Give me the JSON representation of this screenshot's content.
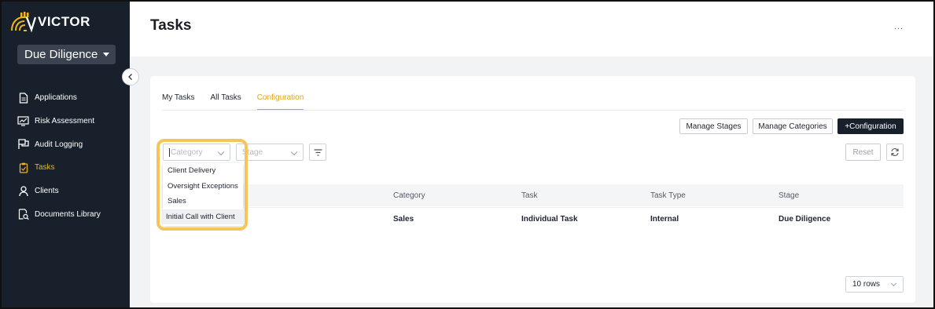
{
  "brand": {
    "name": "VICTOR",
    "accent": "#f0b51e"
  },
  "module_select": {
    "value": "Due Diligence"
  },
  "sidebar": {
    "items": [
      {
        "label": "Applications",
        "icon": "document-icon"
      },
      {
        "label": "Risk Assessment",
        "icon": "chart-monitor-icon"
      },
      {
        "label": "Audit Logging",
        "icon": "flag-icon"
      },
      {
        "label": "Tasks",
        "icon": "tasks-icon",
        "active": true
      },
      {
        "label": "Clients",
        "icon": "user-icon"
      },
      {
        "label": "Documents Library",
        "icon": "document-search-icon"
      }
    ]
  },
  "header": {
    "title": "Tasks",
    "more": "..."
  },
  "tabs": [
    {
      "label": "My Tasks"
    },
    {
      "label": "All Tasks"
    },
    {
      "label": "Configuration",
      "active": true
    }
  ],
  "actions": {
    "manage_stages": "Manage Stages",
    "manage_categories": "Manage Categories",
    "add_configuration": "+Configuration",
    "reset": "Reset"
  },
  "filters": {
    "category_placeholder": "Category",
    "stage_placeholder": "Stage"
  },
  "category_menu": {
    "options": [
      "Client Delivery",
      "Oversight Exceptions",
      "Sales",
      "Initial Call with Client"
    ]
  },
  "table": {
    "columns": [
      "Category",
      "Task",
      "Task Type",
      "Stage"
    ],
    "rows": [
      {
        "category": "Sales",
        "task": "Individual Task",
        "task_type": "Internal",
        "stage": "Due Diligence"
      }
    ]
  },
  "pagination": {
    "rows_per_page": "10 rows"
  }
}
